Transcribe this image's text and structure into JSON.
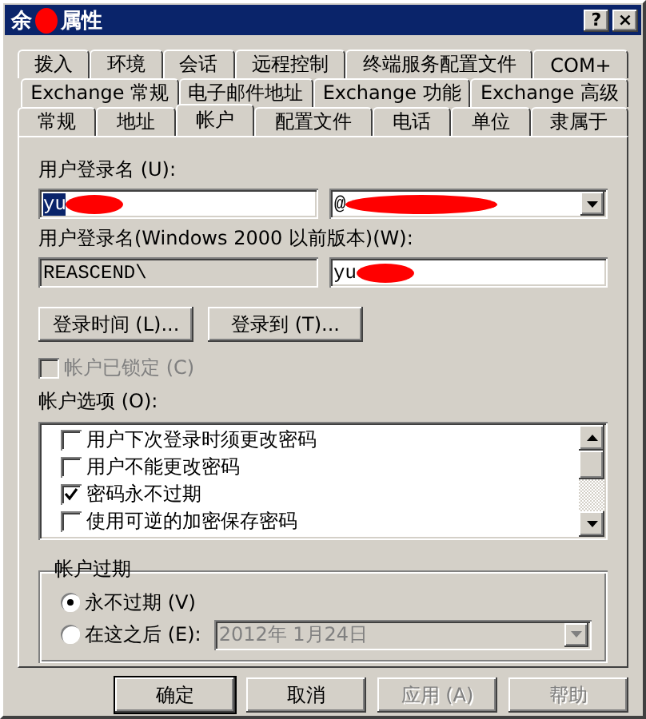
{
  "window": {
    "title_start": "余",
    "title_redacted": true,
    "title_end": "属性",
    "controls": [
      "?",
      "×"
    ]
  },
  "tab_rows": [
    [
      {
        "label": "拨入",
        "selected": false
      },
      {
        "label": "环境",
        "selected": false
      },
      {
        "label": "会话",
        "selected": false
      },
      {
        "label": "远程控制",
        "selected": false
      },
      {
        "label": "终端服务配置文件",
        "selected": false
      },
      {
        "label": "COM+",
        "selected": false
      }
    ],
    [
      {
        "label": "Exchange 常规",
        "selected": false
      },
      {
        "label": "电子邮件地址",
        "selected": false
      },
      {
        "label": "Exchange 功能",
        "selected": false
      },
      {
        "label": "Exchange 高级",
        "selected": false
      }
    ],
    [
      {
        "label": "常规",
        "selected": false
      },
      {
        "label": "地址",
        "selected": false
      },
      {
        "label": "帐户",
        "selected": true
      },
      {
        "label": "配置文件",
        "selected": false
      },
      {
        "label": "电话",
        "selected": false
      },
      {
        "label": "单位",
        "selected": false
      },
      {
        "label": "隶属于",
        "selected": false
      }
    ]
  ],
  "logon_name": {
    "label": "用户登录名 (U):",
    "value": "yu",
    "value_redacted": true,
    "text_selected": true,
    "domain": "@",
    "domain_redacted": true
  },
  "legacy_logon_name": {
    "label": "用户登录名(Windows 2000 以前版本)(W):",
    "domain": "REASCEND\\",
    "value": "yu",
    "value_redacted": true
  },
  "buttons": [
    "登录时间 (L)...",
    "登录到 (T)..."
  ],
  "locked": {
    "label": "帐户已锁定 (C)",
    "checked": false,
    "disabled": true
  },
  "account_options": {
    "label": "帐户选项 (O):",
    "items": [
      {
        "label": "用户下次登录时须更改密码",
        "checked": false
      },
      {
        "label": "用户不能更改密码",
        "checked": false
      },
      {
        "label": "密码永不过期",
        "checked": true
      },
      {
        "label": "使用可逆的加密保存密码",
        "checked": false
      }
    ]
  },
  "expiry": {
    "title": "帐户过期",
    "options": [
      {
        "label": "永不过期 (V)",
        "selected": true
      },
      {
        "label": "在这之后 (E):",
        "selected": false
      }
    ],
    "date": "2012年 1月24日",
    "date_disabled": true
  },
  "footer": [
    {
      "label": "确定",
      "disabled": false,
      "default": true
    },
    {
      "label": "取消",
      "disabled": false,
      "default": false
    },
    {
      "label": "应用 (A)",
      "disabled": true,
      "default": false
    },
    {
      "label": "帮助",
      "disabled": true,
      "default": false
    }
  ]
}
